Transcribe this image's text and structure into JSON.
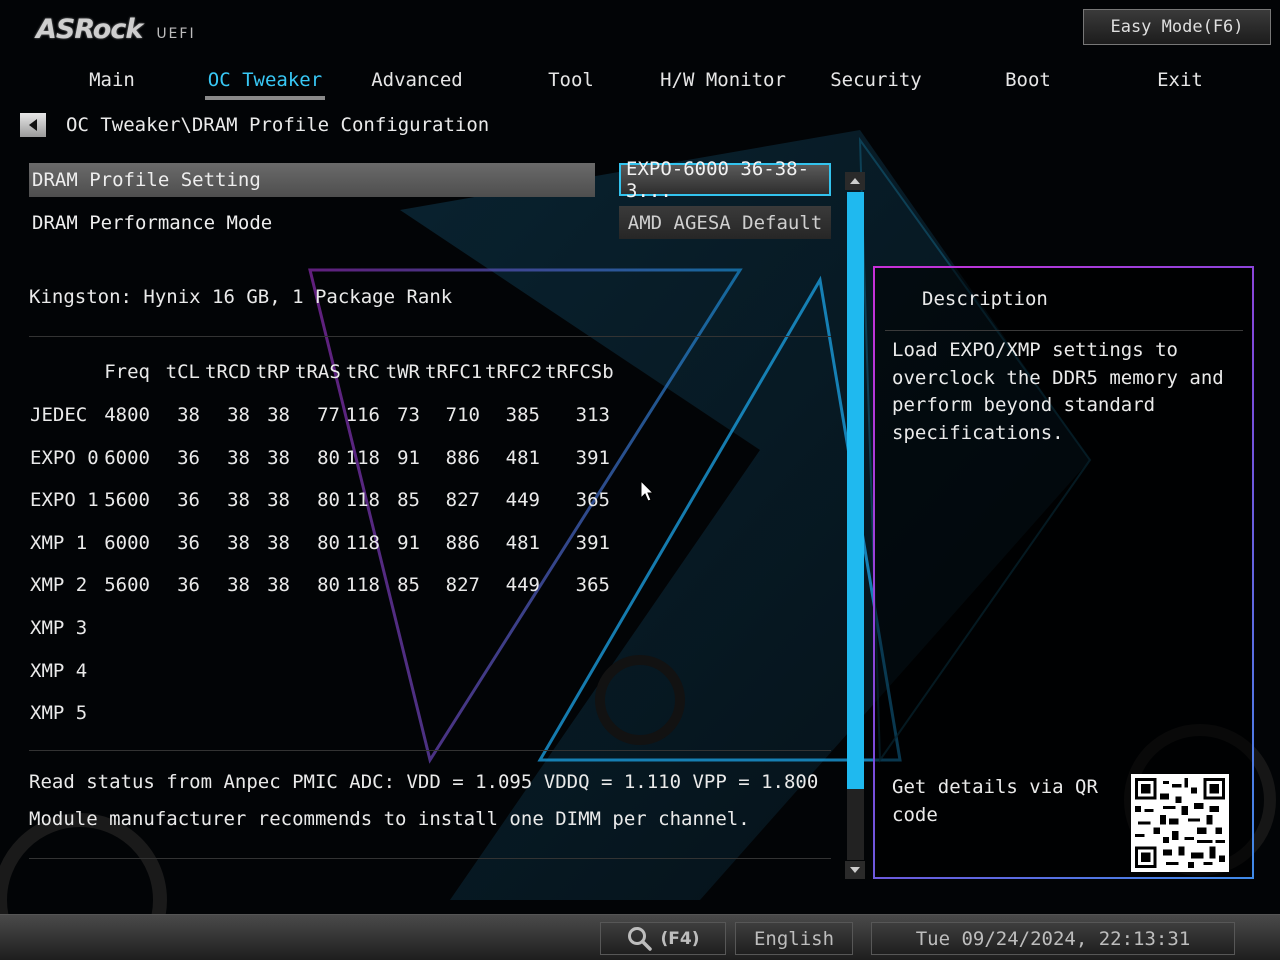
{
  "header": {
    "brand": "ASRock",
    "product": "UEFI",
    "easy_mode_label": "Easy Mode(F6)"
  },
  "tabs": [
    {
      "label": "Main"
    },
    {
      "label": "OC Tweaker"
    },
    {
      "label": "Advanced"
    },
    {
      "label": "Tool"
    },
    {
      "label": "H/W Monitor"
    },
    {
      "label": "Security"
    },
    {
      "label": "Boot"
    },
    {
      "label": "Exit"
    }
  ],
  "active_tab": "OC Tweaker",
  "breadcrumb": "OC Tweaker\\DRAM Profile Configuration",
  "settings": [
    {
      "label": "DRAM Profile Setting",
      "value": "EXPO-6000 36-38-3..."
    },
    {
      "label": "DRAM Performance Mode",
      "value": "AMD AGESA Default"
    }
  ],
  "module_info": "Kingston: Hynix 16 GB, 1 Package Rank",
  "profile_table": {
    "headers": [
      "Freq",
      "tCL",
      "tRCD",
      "tRP",
      "tRAS",
      "tRC",
      "tWR",
      "tRFC1",
      "tRFC2",
      "tRFCSb"
    ],
    "rows": [
      {
        "name": "JEDEC",
        "values": [
          "4800",
          "38",
          "38",
          "38",
          "77",
          "116",
          "73",
          "710",
          "385",
          "313"
        ]
      },
      {
        "name": "EXPO 0",
        "values": [
          "6000",
          "36",
          "38",
          "38",
          "80",
          "118",
          "91",
          "886",
          "481",
          "391"
        ]
      },
      {
        "name": "EXPO 1",
        "values": [
          "5600",
          "36",
          "38",
          "38",
          "80",
          "118",
          "85",
          "827",
          "449",
          "365"
        ]
      },
      {
        "name": "XMP 1",
        "values": [
          "6000",
          "36",
          "38",
          "38",
          "80",
          "118",
          "91",
          "886",
          "481",
          "391"
        ]
      },
      {
        "name": "XMP 2",
        "values": [
          "5600",
          "36",
          "38",
          "38",
          "80",
          "118",
          "85",
          "827",
          "449",
          "365"
        ]
      },
      {
        "name": "XMP 3",
        "values": []
      },
      {
        "name": "XMP 4",
        "values": []
      },
      {
        "name": "XMP 5",
        "values": []
      }
    ]
  },
  "pmic_status": "Read status from Anpec PMIC ADC: VDD = 1.095 VDDQ = 1.110 VPP = 1.800",
  "dimm_note": "Module manufacturer recommends to install one DIMM per channel.",
  "description": {
    "title": "Description",
    "body": "Load EXPO/XMP settings to overclock the DDR5 memory and perform beyond standard specifications.",
    "qr_text": "Get details via QR code"
  },
  "footer": {
    "search_key": "(F4)",
    "language": "English",
    "datetime": "Tue 09/24/2024, 22:13:31"
  },
  "colors": {
    "accent": "#1fb9ef",
    "active_tab": "#38c8f5",
    "panel_border_start": "#c830d8",
    "panel_border_end": "#3f8ae8"
  },
  "icons": [
    "back-arrow-icon",
    "scroll-up-icon",
    "scroll-down-icon",
    "search-icon",
    "mouse-cursor-icon",
    "qr-code-icon",
    "asrock-logo-icon"
  ]
}
